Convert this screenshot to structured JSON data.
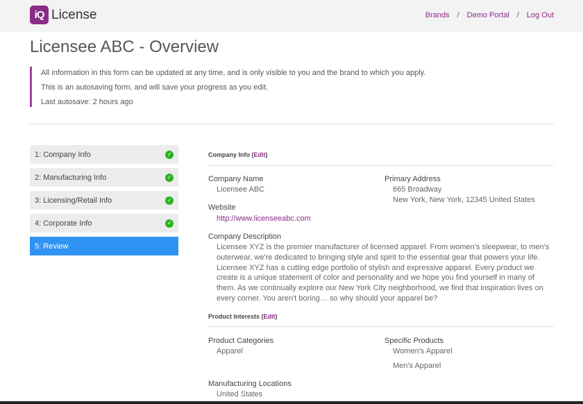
{
  "header": {
    "logo_mark": "iQ",
    "logo_text": "License",
    "nav": [
      "Brands",
      "Demo Portal",
      "Log Out"
    ],
    "nav_separator": "/"
  },
  "page_title": "Licensee ABC - Overview",
  "notice": {
    "lines": [
      "All information in this form can be updated at any time, and is only visible to you and the brand to which you apply.",
      "This is an autosaving form, and will save your progress as you edit.",
      "Last autosave: 2 hours ago"
    ],
    "accent_color": "#a23f9e"
  },
  "steps": [
    {
      "label": "1: Company Info",
      "complete": true
    },
    {
      "label": "2: Manufacturing Info",
      "complete": true
    },
    {
      "label": "3: Licensing/Retail Info",
      "complete": true
    },
    {
      "label": "4: Corporate Info",
      "complete": true
    },
    {
      "label": "5: Review",
      "complete": false,
      "active": true
    }
  ],
  "check_icon": "✓",
  "company_info": {
    "heading": "Company Info",
    "edit_label": "Edit",
    "company_name_label": "Company Name",
    "company_name": "Licensee ABC",
    "primary_address_label": "Primary Address",
    "address_line1": "665 Broadway",
    "address_line2": "New York, New York, 12345 United States",
    "website_label": "Website",
    "website": "http://www.licenseeabc.com",
    "description_label": "Company Description",
    "description": "Licensee XYZ is the premier manufacturer of licensed apparel. From women's sleepwear, to men's outerwear, we're dedicated to bringing style and spirit to the essential gear that powers your life. Licensee XYZ has a cutting edge portfolio of stylish and expressive apparel. Every product we create is a unique statement of color and personality and we hope you find yourself in many of them. As we continually explore our New York City neighborhood, we find that inspiration lives on every corner. You aren't boring… so why should your apparel be?"
  },
  "product_interests": {
    "heading": "Product Interests",
    "edit_label": "Edit",
    "categories_label": "Product Categories",
    "categories": [
      "Apparel"
    ],
    "specific_label": "Specific Products",
    "specific": [
      "Women's Apparel",
      "Men's Apparel"
    ],
    "locations_label": "Manufacturing Locations",
    "locations": [
      "United States"
    ]
  },
  "colors": {
    "brand": "#8b2c87",
    "active_step": "#2f93f3",
    "check": "#2bb31e"
  }
}
